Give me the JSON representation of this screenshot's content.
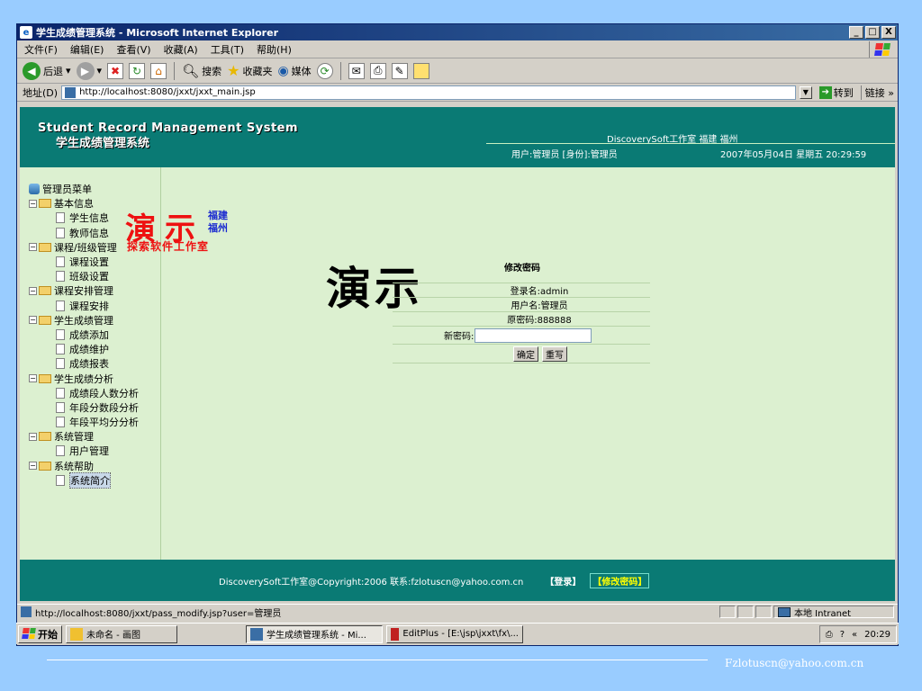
{
  "window": {
    "title": "学生成绩管理系统 - Microsoft Internet Explorer",
    "min": "_",
    "max": "□",
    "close": "X"
  },
  "menu": [
    "文件(F)",
    "编辑(E)",
    "查看(V)",
    "收藏(A)",
    "工具(T)",
    "帮助(H)"
  ],
  "toolbar": {
    "back": "后退",
    "search": "搜索",
    "favorites": "收藏夹",
    "media": "媒体"
  },
  "address": {
    "label": "地址(D)",
    "url": "http://localhost:8080/jxxt/jxxt_main.jsp",
    "go": "转到",
    "links": "链接"
  },
  "header": {
    "title_en": "Student Record Management System",
    "title_cn": "学生成绩管理系统",
    "studio": "DiscoverySoft工作室 福建 福州",
    "user_info": "用户:管理员 [身份]:管理员",
    "datetime": "2007年05月04日 星期五 20:29:59"
  },
  "sidebar": {
    "root": "管理员菜单",
    "groups": [
      {
        "label": "基本信息",
        "items": [
          "学生信息",
          "教师信息"
        ]
      },
      {
        "label": "课程/班级管理",
        "items": [
          "课程设置",
          "班级设置"
        ]
      },
      {
        "label": "课程安排管理",
        "items": [
          "课程安排"
        ]
      },
      {
        "label": "学生成绩管理",
        "items": [
          "成绩添加",
          "成绩维护",
          "成绩报表"
        ]
      },
      {
        "label": "学生成绩分析",
        "items": [
          "成绩段人数分析",
          "年段分数段分析",
          "年段平均分分析"
        ]
      },
      {
        "label": "系统管理",
        "items": [
          "用户管理"
        ]
      },
      {
        "label": "系统帮助",
        "items": [
          "系统简介"
        ]
      }
    ]
  },
  "watermark": {
    "big": "演示",
    "city": "福建",
    "city2": "福州",
    "studio": "探索软件工作室"
  },
  "demo_text": "演示",
  "form": {
    "title": "修改密码",
    "login_name": "登录名:admin",
    "user_name": "用户名:管理员",
    "old_password": "原密码:888888",
    "new_password_label": "新密码:",
    "confirm": "确定",
    "reset": "重写"
  },
  "footer": {
    "copyright": "DiscoverySoft工作室@Copyright:2006 联系:fzlotuscn@yahoo.com.cn",
    "login": "【登录】",
    "change_pw": "【修改密码】"
  },
  "status": {
    "url": "http://localhost:8080/jxxt/pass_modify.jsp?user=管理员",
    "zone": "本地 Intranet"
  },
  "taskbar": {
    "start": "开始",
    "tasks": [
      "未命名 - 画图",
      "学生成绩管理系统 - Mi...",
      "EditPlus - [E:\\jsp\\jxxt\\fx\\..."
    ],
    "time": "20:29"
  },
  "slide_email": "Fzlotuscn@yahoo.com.cn"
}
